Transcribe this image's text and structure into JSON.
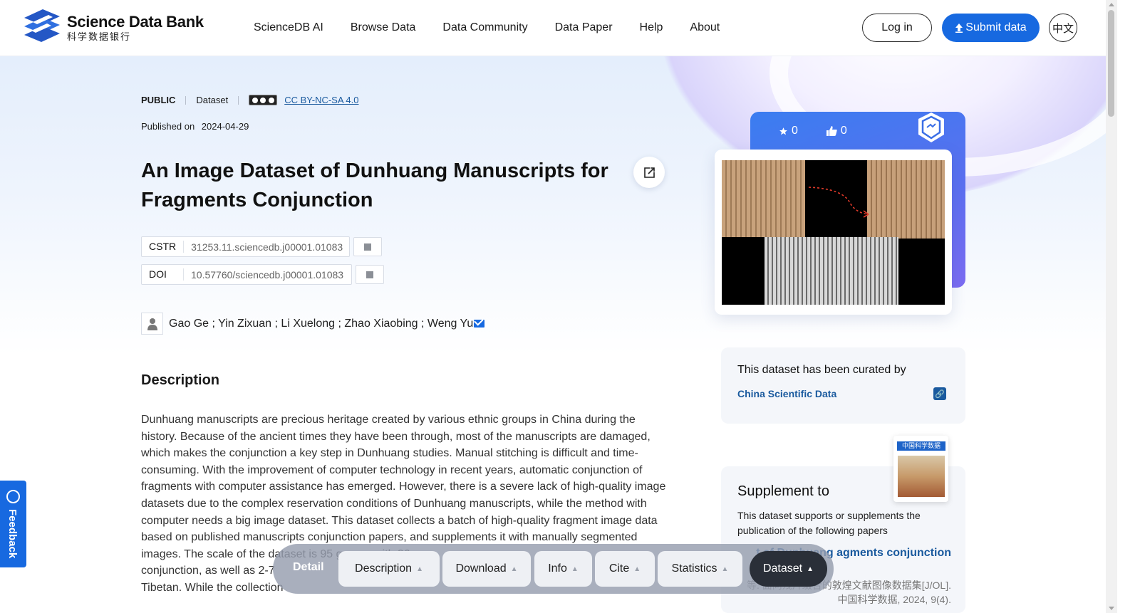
{
  "brand": {
    "title": "Science Data Bank",
    "subtitle": "科学数据银行"
  },
  "nav": [
    "ScienceDB AI",
    "Browse Data",
    "Data Community",
    "Data Paper",
    "Help",
    "About"
  ],
  "auth": {
    "login": "Log in",
    "submit": "Submit data",
    "lang": "中文"
  },
  "meta": {
    "access": "PUBLIC",
    "type": "Dataset",
    "license": "CC BY-NC-SA 4.0",
    "published_label": "Published on",
    "published_date": "2024-04-29"
  },
  "title": "An Image Dataset of Dunhuang Manuscripts for Fragments Conjunction",
  "identifiers": {
    "cstr_label": "CSTR",
    "cstr": "31253.11.sciencedb.j00001.01083",
    "doi_label": "DOI",
    "doi": "10.57760/sciencedb.j00001.01083"
  },
  "authors": "Gao Ge ; Yin Zixuan ; Li Xuelong ; Zhao Xiaobing ; Weng Yu",
  "description": {
    "heading": "Description",
    "text": "Dunhuang manuscripts are precious heritage created by various ethnic groups in China during the history. Because of the ancient times they have been through, most of the manuscripts are damaged, which makes the conjunction a key step in Dunhuang studies. Manual stitching is difficult and time-consuming. With the improvement of computer technology in recent years, automatic conjunction of fragments with computer assistance has emerged. However, there is a severe lack of high-quality image datasets due to the complex reservation conditions of Dunhuang manuscripts, while the method with computer needs a big image dataset. This dataset collects a batch of high-quality fragment image data based on published manuscripts conjunction papers, and supplements it with manually segmented images. The scale of the dataset is 95 groups with 36"
  },
  "desc_tail": [
    "conjunction, as well as 2-7",
    "Tibetan. While the collection"
  ],
  "stats": {
    "favorites": "0",
    "likes": "0"
  },
  "curated": {
    "text": "This dataset has been curated by",
    "org": "China Scientific Data"
  },
  "supplement": {
    "heading": "Supplement to",
    "desc": "This dataset supports or supplements the publication of the following papers",
    "paper": "t of Dunhuang agments conjunction",
    "cn": "等. 面向残片缀合的敦煌文献图像数据集[J/OL]. 中国科学数据, 2024, 9(4)."
  },
  "journal_title": "中国科学数据",
  "tabbar": {
    "detail": "Detail",
    "tabs": [
      "Description",
      "Download",
      "Info",
      "Cite",
      "Statistics",
      "Dataset"
    ],
    "active": "Dataset"
  },
  "feedback": "Feedback",
  "colors": {
    "primary": "#1769e0",
    "link": "#1a5a9e",
    "tab_active": "#2a2f38"
  }
}
